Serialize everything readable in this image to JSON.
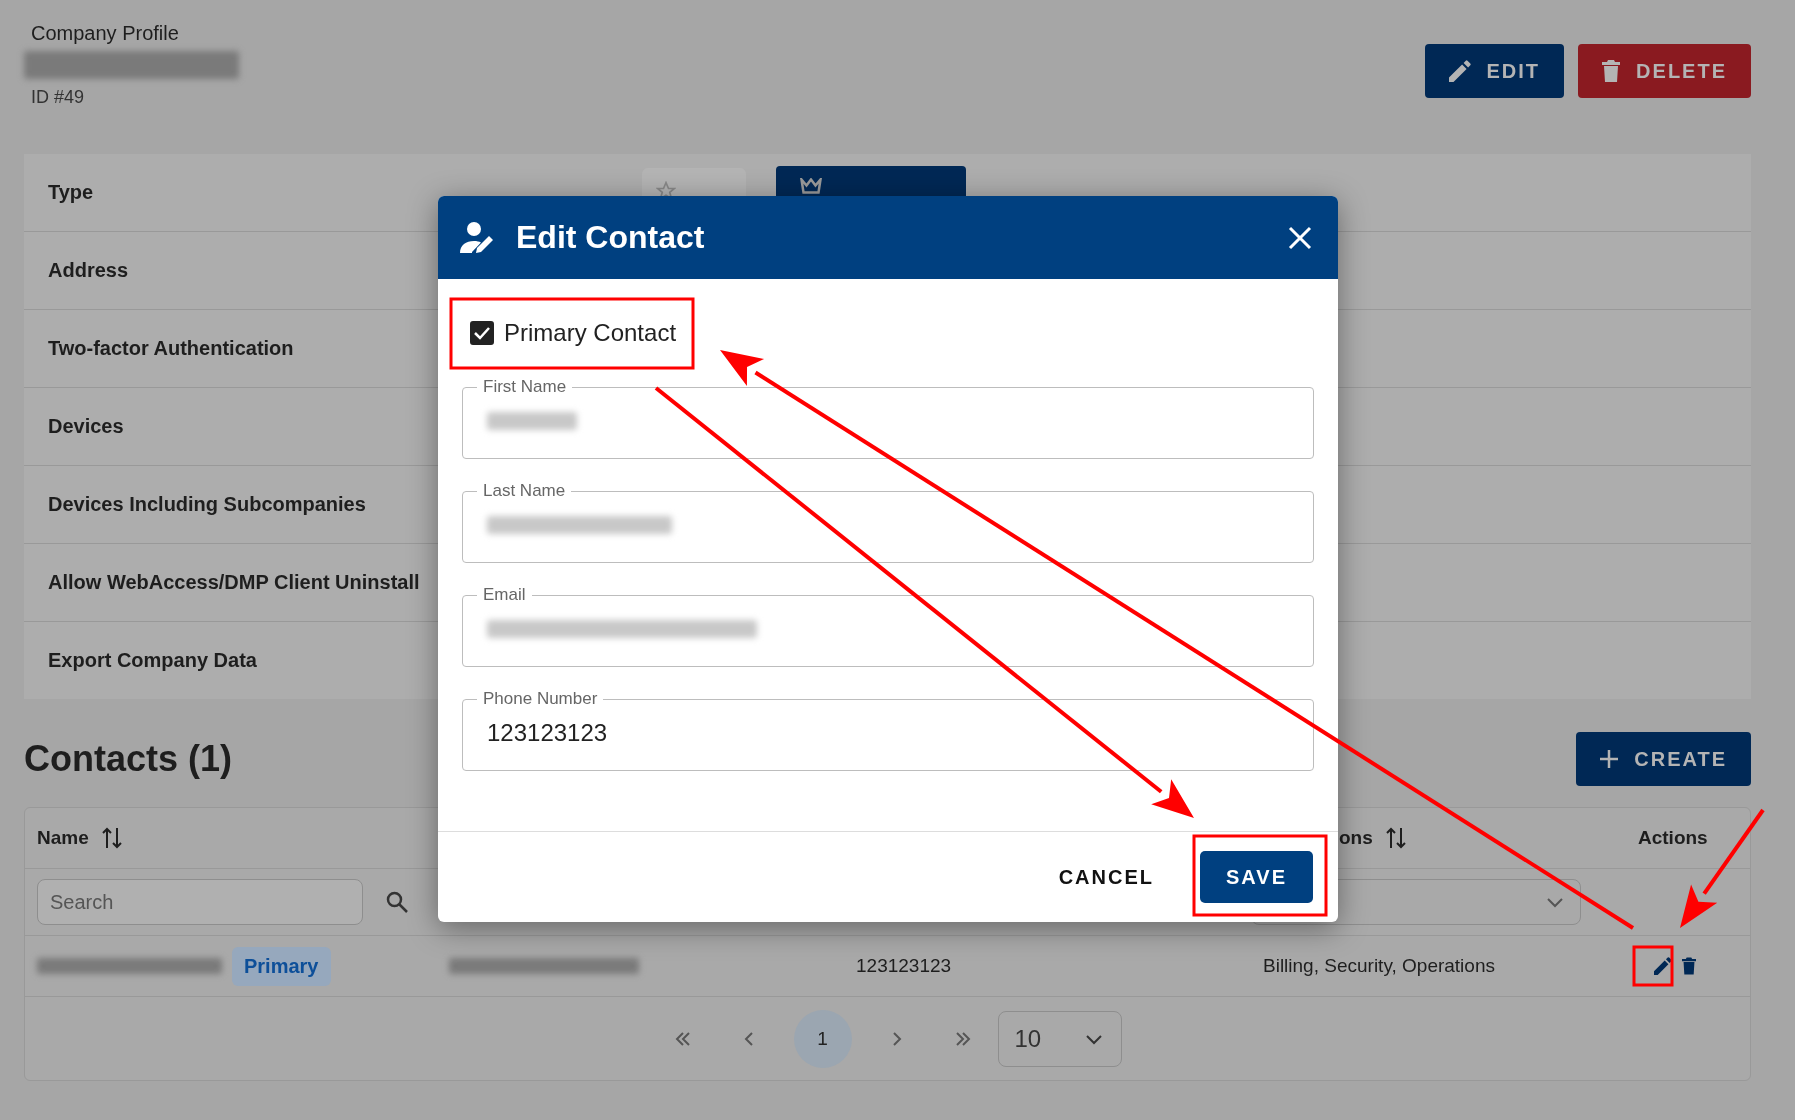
{
  "header": {
    "caption": "Company Profile",
    "id_label": "ID #49",
    "actions": [
      {
        "label": "EDIT",
        "kind": "edit"
      },
      {
        "label": "DELETE",
        "kind": "delete"
      }
    ]
  },
  "details": {
    "rows": [
      {
        "label": "Type"
      },
      {
        "label": "Address"
      },
      {
        "label": "Two-factor Authentication"
      },
      {
        "label": "Devices"
      },
      {
        "label": "Devices Including Subcompanies"
      },
      {
        "label": "Allow WebAccess/DMP Client Uninstall"
      },
      {
        "label": "Export Company Data"
      }
    ]
  },
  "contacts": {
    "title": "Contacts (1)",
    "create_button": "CREATE",
    "name_column": {
      "label": "Name",
      "sortable": true
    },
    "column_4": {
      "label": "ons",
      "sortable": true
    },
    "actions_column": {
      "label": "Actions"
    },
    "search_placeholder": "Search",
    "rows": [
      {
        "primary_badge": "Primary",
        "phone": "123123123",
        "column_4": "Billing, Security, Operations"
      }
    ],
    "pagination": {
      "current_page": "1",
      "page_size": "10"
    }
  },
  "dialog": {
    "title": "Edit Contact",
    "primary_contact": {
      "label": "Primary Contact",
      "checked": true
    },
    "fields": [
      {
        "label": "First Name",
        "redacted": true
      },
      {
        "label": "Last Name",
        "redacted": true
      },
      {
        "label": "Email",
        "redacted": true
      },
      {
        "label": "Phone Number",
        "value": "123123123",
        "redacted": false
      }
    ],
    "buttons": [
      {
        "label": "CANCEL",
        "kind": "text"
      },
      {
        "label": "SAVE",
        "kind": "primary"
      }
    ]
  }
}
